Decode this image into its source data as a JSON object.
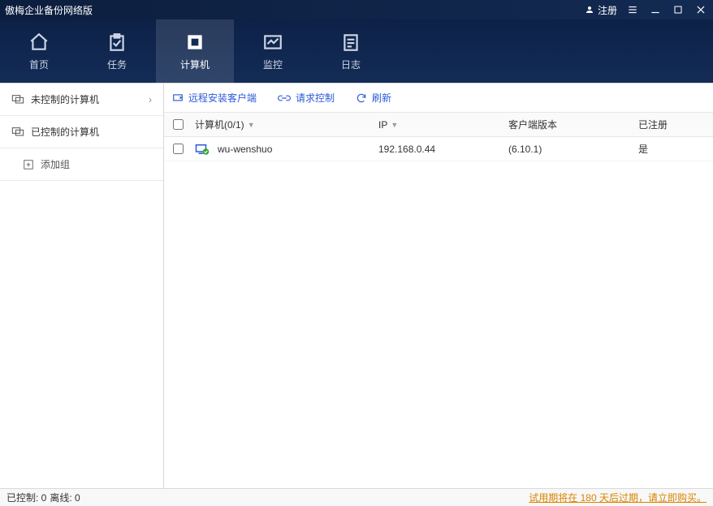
{
  "titlebar": {
    "title": "傲梅企业备份网络版",
    "register": "注册"
  },
  "nav": {
    "items": [
      {
        "label": "首页"
      },
      {
        "label": "任务"
      },
      {
        "label": "计算机"
      },
      {
        "label": "监控"
      },
      {
        "label": "日志"
      }
    ],
    "activeIndex": 2
  },
  "sidebar": {
    "uncontrolled": "未控制的计算机",
    "controlled": "已控制的计算机",
    "addGroup": "添加组"
  },
  "toolbar": {
    "remoteInstall": "远程安装客户端",
    "requestControl": "请求控制",
    "refresh": "刷新"
  },
  "table": {
    "headers": {
      "computer": "计算机(0/1)",
      "ip": "IP",
      "clientVersion": "客户端版本",
      "registered": "已注册"
    },
    "rows": [
      {
        "name": "wu-wenshuo",
        "ip": "192.168.0.44",
        "version": "(6.10.1)",
        "registered": "是"
      }
    ]
  },
  "status": {
    "controlled": "已控制: 0",
    "offline": "离线: 0",
    "trial": "试用期将在 180 天后过期，请立即购买。"
  }
}
